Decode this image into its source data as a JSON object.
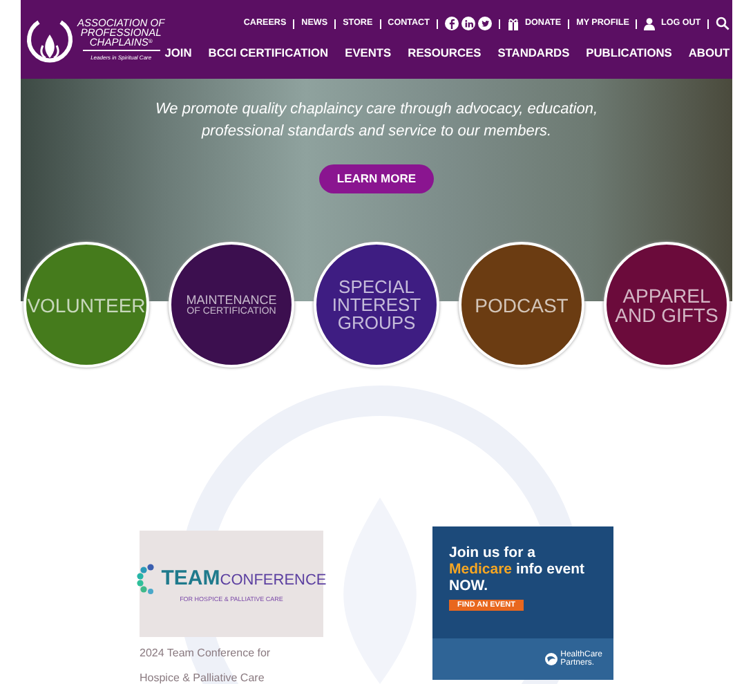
{
  "header": {
    "logo": {
      "lines": [
        "ASSOCIATION OF",
        "PROFESSIONAL",
        "CHAPLAINS"
      ],
      "mark": "®",
      "tagline": "Leaders in Spiritual Care"
    },
    "utility_links": [
      {
        "kind": "link",
        "label": "CAREERS"
      },
      {
        "kind": "link",
        "label": "NEWS"
      },
      {
        "kind": "link",
        "label": "STORE"
      },
      {
        "kind": "link",
        "label": "CONTACT"
      },
      {
        "kind": "social"
      },
      {
        "kind": "gift",
        "label": "DONATE"
      },
      {
        "kind": "link",
        "label": "MY PROFILE"
      },
      {
        "kind": "user",
        "label": "LOG OUT"
      },
      {
        "kind": "search"
      }
    ],
    "nav": [
      "JOIN",
      "BCCI CERTIFICATION",
      "EVENTS",
      "RESOURCES",
      "STANDARDS",
      "PUBLICATIONS",
      "ABOUT"
    ]
  },
  "hero": {
    "tagline_lines": [
      "We promote quality chaplaincy care through advocacy, education,",
      "professional standards and service to our members."
    ],
    "button": "LEARN MORE"
  },
  "tiles": [
    {
      "lines": [
        "VOLUNTEER"
      ],
      "color": "#457b1c"
    },
    {
      "lines": [
        "MAINTENANCE",
        "OF CERTIFICATION"
      ],
      "color": "#3c0f4f"
    },
    {
      "lines": [
        "SPECIAL",
        "INTEREST",
        "GROUPS"
      ],
      "color": "#3e1d82"
    },
    {
      "lines": [
        "PODCAST"
      ],
      "color": "#6b3c12"
    },
    {
      "lines": [
        "APPAREL",
        "AND GIFTS"
      ],
      "color": "#6b0b3b"
    }
  ],
  "features": [
    {
      "kind": "conference",
      "banner": {
        "title_a": "TEAM",
        "title_b": "CONFERENCE",
        "subtitle": "FOR HOSPICE & PALLIATIVE CARE"
      },
      "caption": "2024 Team Conference for Hospice & Palliative Care"
    },
    {
      "kind": "ad",
      "lines": [
        "Join us for a",
        "**Medicare** info event",
        "NOW."
      ],
      "button": "FIND AN EVENT",
      "brand": [
        "HealthCare",
        "Partners."
      ]
    }
  ]
}
